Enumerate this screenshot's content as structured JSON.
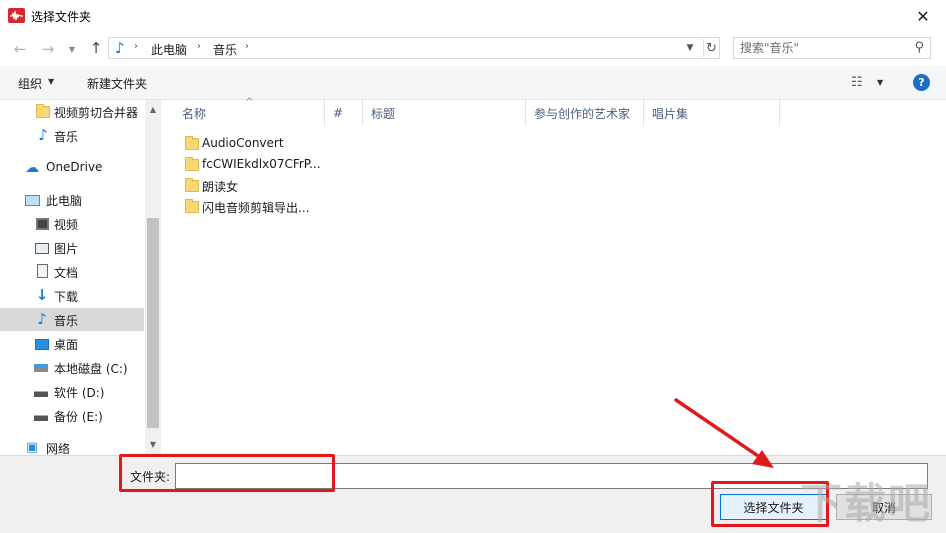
{
  "window": {
    "title": "选择文件夹",
    "close_glyph": "✕",
    "accent_color": "#d8262d"
  },
  "address": {
    "crumbs": [
      "此电脑",
      "音乐"
    ],
    "separator": "›",
    "search_placeholder": "搜索\"音乐\""
  },
  "toolbar": {
    "organize_label": "组织",
    "new_folder_label": "新建文件夹",
    "help_glyph": "?"
  },
  "sidebar": {
    "items": [
      {
        "label": "视频剪切合并器",
        "icon": "folder-icon"
      },
      {
        "label": "音乐",
        "icon": "music-note-icon"
      },
      {
        "label": "OneDrive",
        "icon": "onedrive-cloud-icon"
      },
      {
        "label": "此电脑",
        "icon": "this-pc-icon"
      },
      {
        "label": "视频",
        "icon": "video-icon"
      },
      {
        "label": "图片",
        "icon": "pictures-icon"
      },
      {
        "label": "文档",
        "icon": "documents-icon"
      },
      {
        "label": "下载",
        "icon": "download-icon"
      },
      {
        "label": "音乐",
        "icon": "music-note-icon",
        "selected": true
      },
      {
        "label": "桌面",
        "icon": "desktop-icon"
      },
      {
        "label": "本地磁盘 (C:)",
        "icon": "disk-c-icon"
      },
      {
        "label": "软件 (D:)",
        "icon": "disk-d-icon"
      },
      {
        "label": "备份 (E:)",
        "icon": "disk-e-icon"
      },
      {
        "label": "网络",
        "icon": "network-icon"
      }
    ]
  },
  "columns": [
    "名称",
    "#",
    "标题",
    "参与创作的艺术家",
    "唱片集"
  ],
  "files": [
    {
      "name": "AudioConvert"
    },
    {
      "name": "fcCWIEkdlx07CFrP..."
    },
    {
      "name": "朗读女"
    },
    {
      "name": "闪电音频剪辑导出..."
    }
  ],
  "bottom": {
    "folder_label": "文件夹:",
    "folder_value": "",
    "select_button": "选择文件夹",
    "cancel_button": "取消"
  },
  "annotations": {
    "color": "#e0191b"
  }
}
